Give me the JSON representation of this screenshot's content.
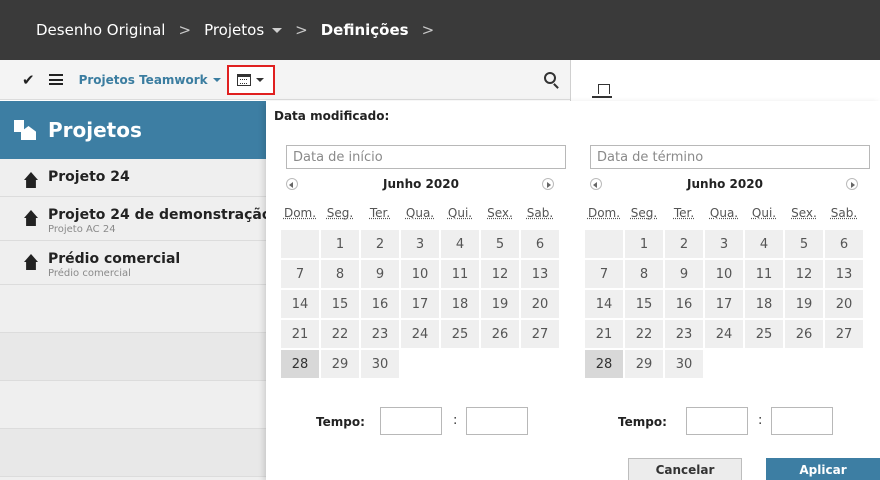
{
  "breadcrumb": {
    "item1": "Desenho Original",
    "sep1": ">",
    "item2": "Projetos",
    "sep2": ">",
    "item3": "Definições",
    "sep3": ">"
  },
  "toolbar": {
    "check_glyph": "✔",
    "project_label": "Projetos Teamwork",
    "icons": [
      "check-icon",
      "menu-icon",
      "calendar-icon",
      "search-icon"
    ]
  },
  "sidebar": {
    "header": "Projetos",
    "items": [
      {
        "title": "Projeto 24",
        "subtitle": ""
      },
      {
        "title": "Projeto 24 de demonstração",
        "subtitle": "Projeto AC 24"
      },
      {
        "title": "Prédio comercial",
        "subtitle": "Prédio comercial"
      }
    ]
  },
  "date_filter": {
    "title": "Data modificado:",
    "start_placeholder": "Data de início",
    "end_placeholder": "Data de término",
    "month_label": "Junho 2020",
    "weekdays": [
      "Dom.",
      "Seg.",
      "Ter.",
      "Qua.",
      "Qui.",
      "Sex.",
      "Sab."
    ],
    "days": [
      [
        "",
        "1",
        "2",
        "3",
        "4",
        "5",
        "6"
      ],
      [
        "7",
        "8",
        "9",
        "10",
        "11",
        "12",
        "13"
      ],
      [
        "14",
        "15",
        "16",
        "17",
        "18",
        "19",
        "20"
      ],
      [
        "21",
        "22",
        "23",
        "24",
        "25",
        "26",
        "27"
      ],
      [
        "28",
        "29",
        "30",
        "",
        "",
        "",
        ""
      ]
    ],
    "selected_day": "28",
    "time_label": "Tempo:",
    "time_separator": ":",
    "cancel_label": "Cancelar",
    "apply_label": "Aplicar"
  },
  "colors": {
    "topbar": "#3a3a3a",
    "accent": "#3d7ea3",
    "highlight_border": "#e02020"
  }
}
